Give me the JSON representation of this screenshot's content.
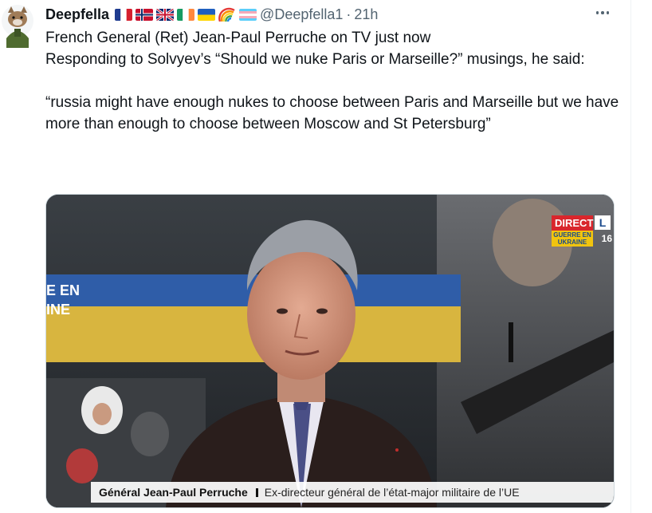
{
  "tweet": {
    "author": {
      "name": "Deepfella",
      "handle": "@Deepfella1",
      "flags": [
        "france-flag",
        "norway-flag",
        "uk-flag",
        "ireland-flag",
        "ukraine-flag",
        "rainbow-emoji",
        "trans-flag"
      ]
    },
    "separator": "·",
    "time": "21h",
    "text": {
      "line1": "French General (Ret) Jean-Paul Perruche on TV just now",
      "line2": "Responding to Solvyev’s “Should we nuke Paris or Marseille?” musings, he said:",
      "quote": "“russia might have enough nukes to choose between Paris and Marseille but we have more than enough to choose between Moscow and St Petersburg”"
    },
    "media": {
      "badge_live": "DIRECT",
      "badge_sub_1": "GUERRE EN",
      "badge_sub_2": "UKRAINE",
      "channel_logo": "L",
      "badge_time": "16",
      "caption_name": "Général Jean-Paul Perruche",
      "caption_desc": "Ex-directeur général de l’état-major militaire de l’UE",
      "background_text_1": "E EN",
      "background_text_2": "INE"
    }
  },
  "colors": {
    "text_primary": "#0f1419",
    "text_secondary": "#536471",
    "border": "#cfd9de",
    "live_red": "#d9262c",
    "ukraine_blue": "#2f5da8",
    "ukraine_yellow": "#e8c544"
  }
}
